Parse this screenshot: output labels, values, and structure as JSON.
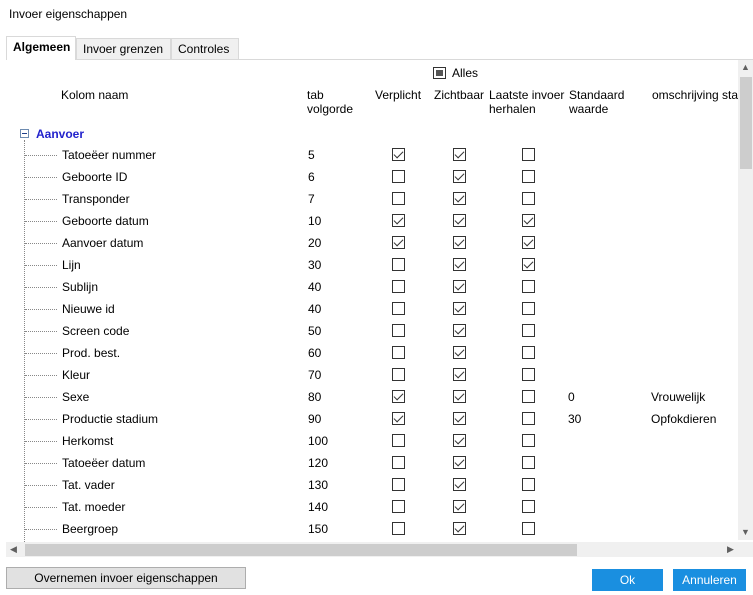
{
  "window": {
    "title": "Invoer eigenschappen"
  },
  "tabs": [
    {
      "label": "Algemeen",
      "active": true
    },
    {
      "label": "Invoer grenzen",
      "active": false
    },
    {
      "label": "Controles",
      "active": false
    }
  ],
  "grid": {
    "select_all_label": "Alles",
    "columns": {
      "name": "Kolom naam",
      "tab_order": "tab\nvolgorde",
      "required": "Verplicht",
      "visible": "Zichtbaar",
      "repeat": "Laatste invoer\nherhalen",
      "default": "Standaard\nwaarde",
      "description": "omschrijving sta"
    },
    "group": {
      "label": "Aanvoer",
      "expanded": true
    },
    "rows": [
      {
        "name": "Tatoeëer nummer",
        "order": "5",
        "required": true,
        "visible": true,
        "repeat": false,
        "default": "",
        "description": ""
      },
      {
        "name": "Geboorte ID",
        "order": "6",
        "required": false,
        "visible": true,
        "repeat": false,
        "default": "",
        "description": ""
      },
      {
        "name": "Transponder",
        "order": "7",
        "required": false,
        "visible": true,
        "repeat": false,
        "default": "",
        "description": ""
      },
      {
        "name": "Geboorte datum",
        "order": "10",
        "required": true,
        "visible": true,
        "repeat": true,
        "default": "",
        "description": ""
      },
      {
        "name": "Aanvoer datum",
        "order": "20",
        "required": true,
        "visible": true,
        "repeat": true,
        "default": "",
        "description": ""
      },
      {
        "name": "Lijn",
        "order": "30",
        "required": false,
        "visible": true,
        "repeat": true,
        "default": "",
        "description": ""
      },
      {
        "name": "Sublijn",
        "order": "40",
        "required": false,
        "visible": true,
        "repeat": false,
        "default": "",
        "description": ""
      },
      {
        "name": "Nieuwe id",
        "order": "40",
        "required": false,
        "visible": true,
        "repeat": false,
        "default": "",
        "description": ""
      },
      {
        "name": "Screen code",
        "order": "50",
        "required": false,
        "visible": true,
        "repeat": false,
        "default": "",
        "description": ""
      },
      {
        "name": "Prod. best.",
        "order": "60",
        "required": false,
        "visible": true,
        "repeat": false,
        "default": "",
        "description": ""
      },
      {
        "name": "Kleur",
        "order": "70",
        "required": false,
        "visible": true,
        "repeat": false,
        "default": "",
        "description": ""
      },
      {
        "name": "Sexe",
        "order": "80",
        "required": true,
        "visible": true,
        "repeat": false,
        "default": "0",
        "description": "Vrouwelijk"
      },
      {
        "name": "Productie stadium",
        "order": "90",
        "required": true,
        "visible": true,
        "repeat": false,
        "default": "30",
        "description": "Opfokdieren"
      },
      {
        "name": "Herkomst",
        "order": "100",
        "required": false,
        "visible": true,
        "repeat": false,
        "default": "",
        "description": ""
      },
      {
        "name": "Tatoeëer datum",
        "order": "120",
        "required": false,
        "visible": true,
        "repeat": false,
        "default": "",
        "description": ""
      },
      {
        "name": "Tat. vader",
        "order": "130",
        "required": false,
        "visible": true,
        "repeat": false,
        "default": "",
        "description": ""
      },
      {
        "name": "Tat. moeder",
        "order": "140",
        "required": false,
        "visible": true,
        "repeat": false,
        "default": "",
        "description": ""
      },
      {
        "name": "Beergroep",
        "order": "150",
        "required": false,
        "visible": true,
        "repeat": false,
        "default": "",
        "description": ""
      }
    ]
  },
  "scrollbars": {
    "up_icon": "▲",
    "down_icon": "▼",
    "left_icon": "◀",
    "right_icon": "▶"
  },
  "footer": {
    "copy_button": "Overnemen invoer eigenschappen",
    "ok_button": "Ok",
    "cancel_button": "Annuleren"
  },
  "colors": {
    "accent": "#1a8fe0",
    "group_label": "#2222cc"
  }
}
